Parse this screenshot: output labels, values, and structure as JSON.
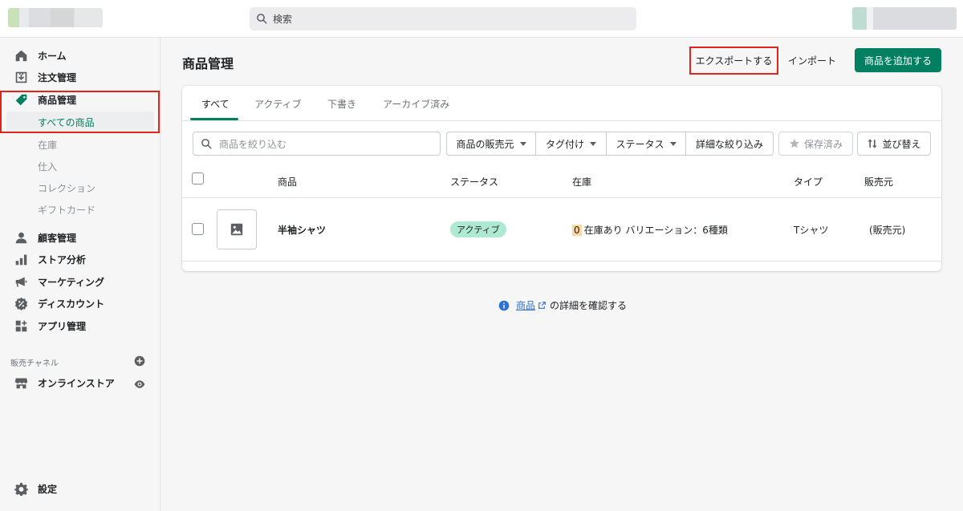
{
  "topbar": {
    "search_placeholder": "検索"
  },
  "sidebar": {
    "items": [
      {
        "label": "ホーム",
        "icon": "home-icon"
      },
      {
        "label": "注文管理",
        "icon": "orders-icon"
      },
      {
        "label": "商品管理",
        "icon": "tag-icon"
      },
      {
        "label": "顧客管理",
        "icon": "person-icon"
      },
      {
        "label": "ストア分析",
        "icon": "analytics-icon"
      },
      {
        "label": "マーケティング",
        "icon": "megaphone-icon"
      },
      {
        "label": "ディスカウント",
        "icon": "discount-icon"
      },
      {
        "label": "アプリ管理",
        "icon": "apps-icon"
      }
    ],
    "sub_items": [
      "すべての商品",
      "在庫",
      "仕入",
      "コレクション",
      "ギフトカード"
    ],
    "channels_label": "販売チャネル",
    "online_store": "オンラインストア",
    "settings": "設定"
  },
  "main": {
    "title": "商品管理",
    "export_label": "エクスポートする",
    "import_label": "インポート",
    "add_label": "商品を追加する",
    "tabs": [
      "すべて",
      "アクティブ",
      "下書き",
      "アーカイブ済み"
    ],
    "filter_placeholder": "商品を絞り込む",
    "filters": [
      "商品の販売元",
      "タグ付け",
      "ステータス",
      "詳細な絞り込み"
    ],
    "saved_label": "保存済み",
    "sort_label": "並び替え",
    "columns": [
      "商品",
      "ステータス",
      "在庫",
      "タイプ",
      "販売元"
    ],
    "rows": [
      {
        "name": "半袖シャツ",
        "status": "アクティブ",
        "stock_count": "0",
        "stock_text": "在庫あり バリエーション：6種類",
        "type": "Tシャツ",
        "vendor": "(販売元)"
      }
    ],
    "help_link": "商品",
    "help_text": "の詳細を確認する"
  },
  "colors": {
    "accent": "#008060",
    "highlight_box": "#e1251b",
    "link": "#2c6ecb",
    "badge_active": "#aee9d1"
  }
}
